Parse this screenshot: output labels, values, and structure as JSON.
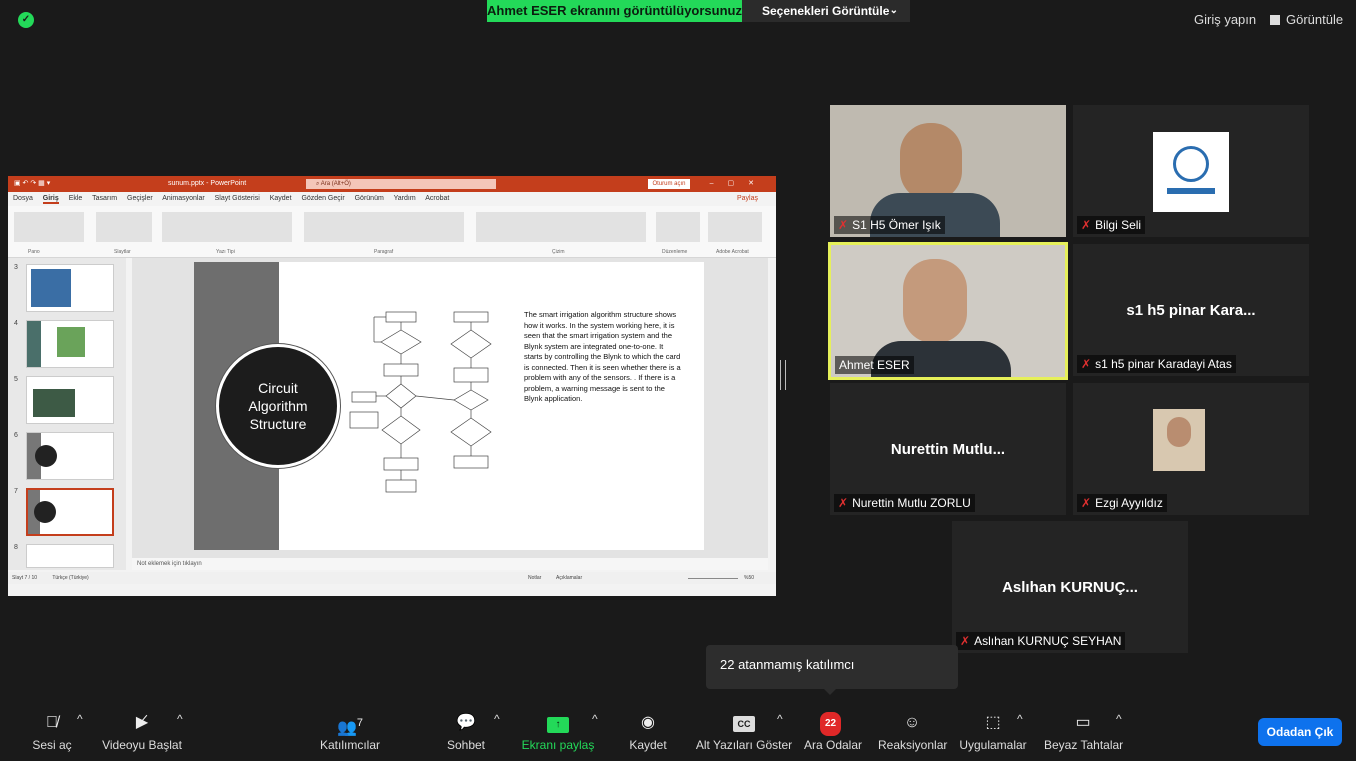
{
  "top": {
    "share_banner": "Ahmet ESER ekranını görüntülüyorsunuz",
    "view_options": "Seçenekleri Görüntüle",
    "sign_in": "Giriş yapın",
    "view": "Görüntüle"
  },
  "ppt": {
    "file_name": "sunum.pptx  -  PowerPoint",
    "search_placeholder": "Ara (Alt+Ö)",
    "login": "Oturum açın",
    "tabs": [
      "Dosya",
      "Giriş",
      "Ekle",
      "Tasarım",
      "Geçişler",
      "Animasyonlar",
      "Slayt Gösterisi",
      "Kaydet",
      "Gözden Geçir",
      "Görünüm",
      "Yardım",
      "Acrobat"
    ],
    "share": "Paylaş",
    "groups": [
      "Pano",
      "Slaytlar",
      "Yazı Tipi",
      "Paragraf",
      "Çizim",
      "Düzenleme",
      "Adobe Acrobat"
    ],
    "slide_numbers": [
      "3",
      "4",
      "5",
      "6",
      "7",
      "8"
    ],
    "slide_title": "Circuit Algorithm Structure",
    "slide_text": "The smart irrigation algorithm structure shows how it works. In the system working here, it is seen that the smart irrigation system and the Blynk system are integrated one-to-one. It starts by controlling the Blynk to which the card is connected. Then it is seen whether there is a problem with any of the sensors. . If there is a problem, a warning message is sent to the Blynk application.",
    "notes": "Not eklemek için tıklayın",
    "status_slide": "Slayt 7 / 10",
    "status_lang": "Türkçe (Türkiye)",
    "status_notes": "Notlar",
    "status_comments": "Açıklamalar",
    "zoom": "%50"
  },
  "participants": [
    {
      "name": "S1 H5 Ömer Işık",
      "muted": true
    },
    {
      "name": "Bilgi Seli",
      "muted": true
    },
    {
      "name": "Ahmet ESER",
      "muted": false
    },
    {
      "name": "s1 h5 pinar Karadayi Atas",
      "short": "s1 h5 pinar Kara...",
      "muted": true
    },
    {
      "name": "Nurettin Mutlu ZORLU",
      "short": "Nurettin  Mutlu...",
      "muted": true
    },
    {
      "name": "Ezgi Ayyıldız",
      "muted": true
    },
    {
      "name": "Aslıhan KURNUÇ SEYHAN",
      "short": "Aslıhan  KURNUÇ...",
      "muted": true
    }
  ],
  "tooltip": "22 atanmamış katılımcı",
  "toolbar": {
    "unmute": "Sesi aç",
    "start_video": "Videoyu Başlat",
    "participants": "Katılımcılar",
    "participants_count": "7",
    "chat": "Sohbet",
    "share_screen": "Ekranı paylaş",
    "record": "Kaydet",
    "captions": "Alt Yazıları Göster",
    "cc": "CC",
    "breakout": "Ara Odalar",
    "breakout_badge": "22",
    "reactions": "Reaksiyonlar",
    "apps": "Uygulamalar",
    "whiteboard": "Beyaz Tahtalar",
    "leave": "Odadan Çık"
  },
  "colors": {
    "accent_green": "#23d959",
    "leave_blue": "#0e72ed",
    "ppt_red": "#c43e1c",
    "active_border": "#e6f05a"
  }
}
